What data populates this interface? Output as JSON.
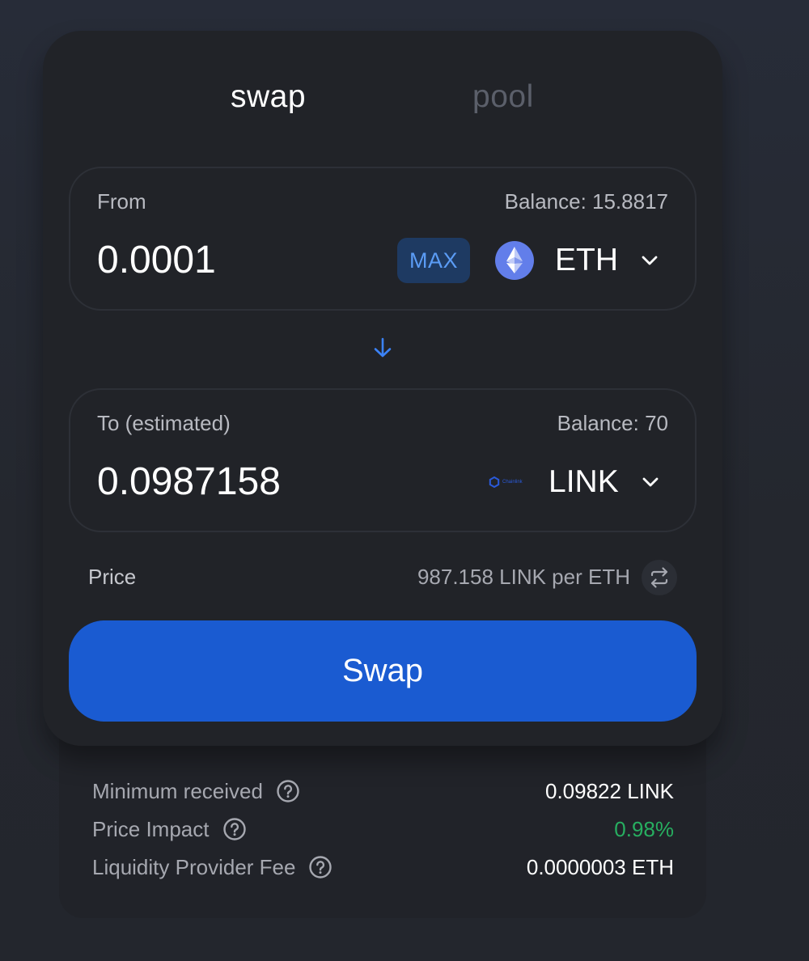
{
  "tabs": {
    "swap": "swap",
    "pool": "pool"
  },
  "from": {
    "label": "From",
    "balance": "Balance: 15.8817",
    "amount": "0.0001",
    "max_label": "MAX",
    "token": "ETH",
    "token_icon": "ethereum-icon"
  },
  "to": {
    "label": "To (estimated)",
    "balance": "Balance: 70",
    "amount": "0.0987158",
    "token": "LINK",
    "token_icon": "chainlink-icon",
    "token_logo_text": "Chainlink"
  },
  "price": {
    "label": "Price",
    "value": "987.158 LINK per ETH"
  },
  "swap_button": "Swap",
  "details": {
    "minimum_received": {
      "label": "Minimum received",
      "value": "0.09822 LINK"
    },
    "price_impact": {
      "label": "Price Impact",
      "value": "0.98%"
    },
    "lp_fee": {
      "label": "Liquidity Provider Fee",
      "value": "0.0000003 ETH"
    }
  },
  "colors": {
    "accent": "#1a5bd1",
    "max_bg": "#1e3a62",
    "max_text": "#5b9cf5",
    "good": "#27ae60",
    "eth": "#627eea"
  }
}
